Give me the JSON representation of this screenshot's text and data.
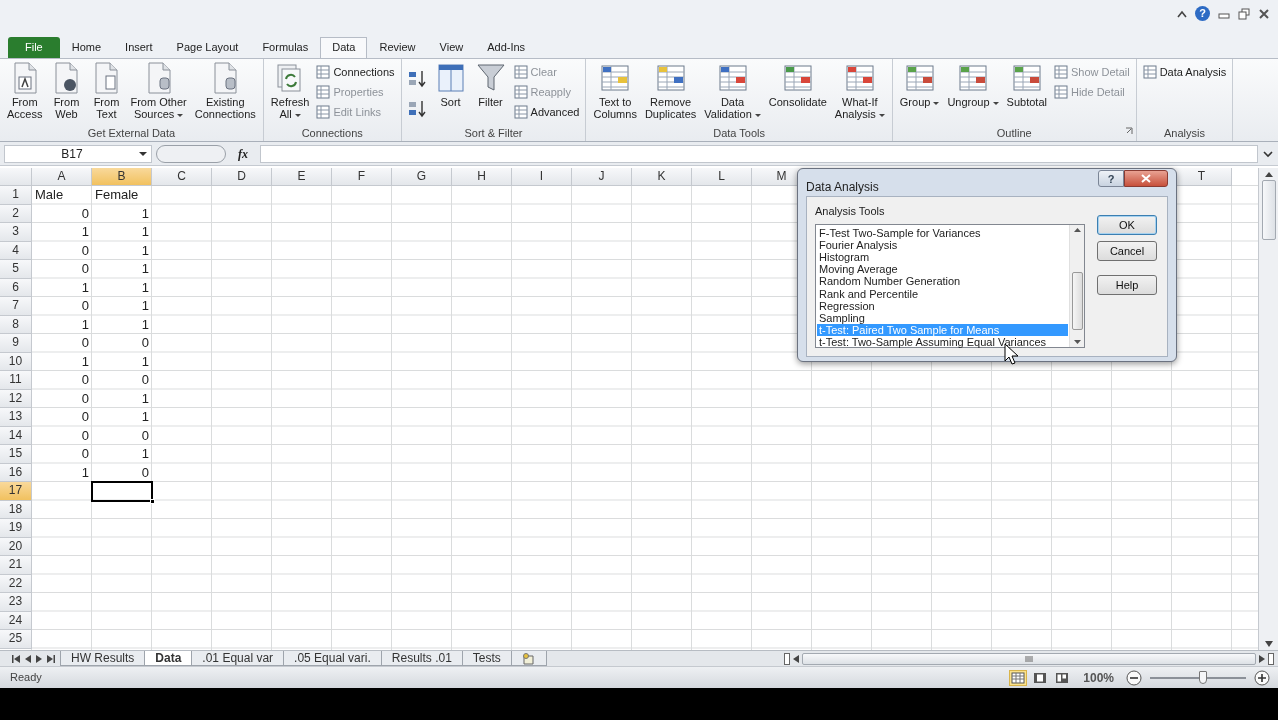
{
  "ribbon": {
    "tabs": [
      {
        "label": "File",
        "kind": "file",
        "selected": false
      },
      {
        "label": "Home",
        "kind": "tab",
        "selected": false
      },
      {
        "label": "Insert",
        "kind": "tab",
        "selected": false
      },
      {
        "label": "Page Layout",
        "kind": "tab",
        "selected": false
      },
      {
        "label": "Formulas",
        "kind": "tab",
        "selected": false
      },
      {
        "label": "Data",
        "kind": "tab",
        "selected": true
      },
      {
        "label": "Review",
        "kind": "tab",
        "selected": false
      },
      {
        "label": "View",
        "kind": "tab",
        "selected": false
      },
      {
        "label": "Add-Ins",
        "kind": "tab",
        "selected": false
      }
    ],
    "help": "?",
    "groups": [
      {
        "title": "Get External Data",
        "entries": [
          {
            "kind": "large",
            "label": "From\nAccess"
          },
          {
            "kind": "large",
            "label": "From\nWeb"
          },
          {
            "kind": "large",
            "label": "From\nText"
          },
          {
            "kind": "large",
            "label": "From Other\nSources",
            "dropdown": true
          },
          {
            "kind": "large",
            "label": "Existing\nConnections"
          }
        ]
      },
      {
        "title": "Connections",
        "entries": [
          {
            "kind": "large",
            "label": "Refresh\nAll",
            "dropdown": true
          },
          {
            "kind": "stack",
            "items": [
              {
                "label": "Connections",
                "disabled": false
              },
              {
                "label": "Properties",
                "disabled": true
              },
              {
                "label": "Edit Links",
                "disabled": true
              }
            ]
          }
        ]
      },
      {
        "title": "Sort & Filter",
        "entries": [
          {
            "kind": "iconstack",
            "items": [
              {
                "kind": "ascending"
              },
              {
                "kind": "descending"
              }
            ]
          },
          {
            "kind": "large",
            "label": "Sort"
          },
          {
            "kind": "large",
            "label": "Filter"
          },
          {
            "kind": "stack",
            "items": [
              {
                "label": "Clear",
                "disabled": true
              },
              {
                "label": "Reapply",
                "disabled": true
              },
              {
                "label": "Advanced",
                "disabled": false
              }
            ]
          }
        ]
      },
      {
        "title": "Data Tools",
        "entries": [
          {
            "kind": "large",
            "label": "Text to\nColumns"
          },
          {
            "kind": "large",
            "label": "Remove\nDuplicates"
          },
          {
            "kind": "large",
            "label": "Data\nValidation",
            "dropdown": true
          },
          {
            "kind": "large",
            "label": "Consolidate"
          },
          {
            "kind": "large",
            "label": "What-If\nAnalysis",
            "dropdown": true
          }
        ]
      },
      {
        "title": "Outline",
        "launcher": true,
        "entries": [
          {
            "kind": "large",
            "label": "Group",
            "dropdown": true
          },
          {
            "kind": "large",
            "label": "Ungroup",
            "dropdown": true
          },
          {
            "kind": "large",
            "label": "Subtotal"
          },
          {
            "kind": "stack",
            "items": [
              {
                "label": "Show Detail",
                "disabled": true
              },
              {
                "label": "Hide Detail",
                "disabled": true
              }
            ]
          }
        ]
      },
      {
        "title": "Analysis",
        "entries": [
          {
            "kind": "stack",
            "items": [
              {
                "label": "Data Analysis",
                "disabled": false
              }
            ]
          }
        ]
      }
    ]
  },
  "formula_bar": {
    "name_box": "B17",
    "fx": "fx"
  },
  "sheet": {
    "columns": [
      {
        "label": "A",
        "kind": "col",
        "selected": false
      },
      {
        "label": "B",
        "kind": "col",
        "selected": true
      },
      {
        "label": "C",
        "kind": "col",
        "selected": false
      },
      {
        "label": "D",
        "kind": "col",
        "selected": false
      },
      {
        "label": "E",
        "kind": "col",
        "selected": false
      },
      {
        "label": "F",
        "kind": "col",
        "selected": false
      },
      {
        "label": "G",
        "kind": "col",
        "selected": false
      },
      {
        "label": "H",
        "kind": "col",
        "selected": false
      },
      {
        "label": "I",
        "kind": "col",
        "selected": false
      },
      {
        "label": "J",
        "kind": "col",
        "selected": false
      },
      {
        "label": "K",
        "kind": "col",
        "selected": false
      },
      {
        "label": "L",
        "kind": "col",
        "selected": false
      },
      {
        "label": "M",
        "kind": "col",
        "selected": false
      },
      {
        "kind": "covered"
      },
      {
        "kind": "covered"
      },
      {
        "kind": "covered"
      },
      {
        "kind": "covered"
      },
      {
        "kind": "covered"
      },
      {
        "kind": "covered"
      },
      {
        "label": "T",
        "kind": "col",
        "selected": false
      }
    ],
    "rows": [
      {
        "label": "1",
        "kind": "text",
        "selected": false,
        "cells": [
          "Male",
          "Female"
        ]
      },
      {
        "label": "2",
        "kind": "number",
        "selected": false,
        "cells": [
          "0",
          "1"
        ]
      },
      {
        "label": "3",
        "kind": "number",
        "selected": false,
        "cells": [
          "1",
          "1"
        ]
      },
      {
        "label": "4",
        "kind": "number",
        "selected": false,
        "cells": [
          "0",
          "1"
        ]
      },
      {
        "label": "5",
        "kind": "number",
        "selected": false,
        "cells": [
          "0",
          "1"
        ]
      },
      {
        "label": "6",
        "kind": "number",
        "selected": false,
        "cells": [
          "1",
          "1"
        ]
      },
      {
        "label": "7",
        "kind": "number",
        "selected": false,
        "cells": [
          "0",
          "1"
        ]
      },
      {
        "label": "8",
        "kind": "number",
        "selected": false,
        "cells": [
          "1",
          "1"
        ]
      },
      {
        "label": "9",
        "kind": "number",
        "selected": false,
        "cells": [
          "0",
          "0"
        ]
      },
      {
        "label": "10",
        "kind": "number",
        "selected": false,
        "cells": [
          "1",
          "1"
        ]
      },
      {
        "label": "11",
        "kind": "number",
        "selected": false,
        "cells": [
          "0",
          "0"
        ]
      },
      {
        "label": "12",
        "kind": "number",
        "selected": false,
        "cells": [
          "0",
          "1"
        ]
      },
      {
        "label": "13",
        "kind": "number",
        "selected": false,
        "cells": [
          "0",
          "1"
        ]
      },
      {
        "label": "14",
        "kind": "number",
        "selected": false,
        "cells": [
          "0",
          "0"
        ]
      },
      {
        "label": "15",
        "kind": "number",
        "selected": false,
        "cells": [
          "0",
          "1"
        ]
      },
      {
        "label": "16",
        "kind": "number",
        "selected": false,
        "cells": [
          "1",
          "0"
        ]
      },
      {
        "label": "17",
        "selected": true
      },
      {
        "label": "18",
        "selected": false
      },
      {
        "label": "19",
        "selected": false
      },
      {
        "label": "20",
        "selected": false
      },
      {
        "label": "21",
        "selected": false
      },
      {
        "label": "22",
        "selected": false
      },
      {
        "label": "23",
        "selected": false
      },
      {
        "label": "24",
        "selected": false
      },
      {
        "label": "25",
        "selected": false
      }
    ]
  },
  "dialog": {
    "title": "Data Analysis",
    "help_button": "?",
    "list_label": "Analysis Tools",
    "items": [
      {
        "label": "F-Test Two-Sample for Variances",
        "selected": false
      },
      {
        "label": "Fourier Analysis",
        "selected": false
      },
      {
        "label": "Histogram",
        "selected": false
      },
      {
        "label": "Moving Average",
        "selected": false
      },
      {
        "label": "Random Number Generation",
        "selected": false
      },
      {
        "label": "Rank and Percentile",
        "selected": false
      },
      {
        "label": "Regression",
        "selected": false
      },
      {
        "label": "Sampling",
        "selected": false
      },
      {
        "label": "t-Test: Paired Two Sample for Means",
        "selected": true
      },
      {
        "label": "t-Test: Two-Sample Assuming Equal Variances",
        "selected": false
      }
    ],
    "buttons": [
      {
        "label": "OK",
        "default": true
      },
      {
        "label": "Cancel",
        "default": false
      },
      {
        "label": "Help",
        "default": false
      }
    ]
  },
  "sheet_tabs": [
    {
      "label": "HW Results",
      "selected": false
    },
    {
      "label": "Data",
      "selected": true
    },
    {
      "label": ".01 Equal var",
      "selected": false
    },
    {
      "label": ".05 Equal vari.",
      "selected": false
    },
    {
      "label": "Results .01",
      "selected": false
    },
    {
      "label": "Tests",
      "selected": false
    }
  ],
  "status_bar": {
    "text": "Ready",
    "views": [
      {
        "selected": true
      },
      {
        "selected": false
      },
      {
        "selected": false
      }
    ],
    "zoom": "100%",
    "zoom_slider": {
      "level": 0.55
    }
  }
}
